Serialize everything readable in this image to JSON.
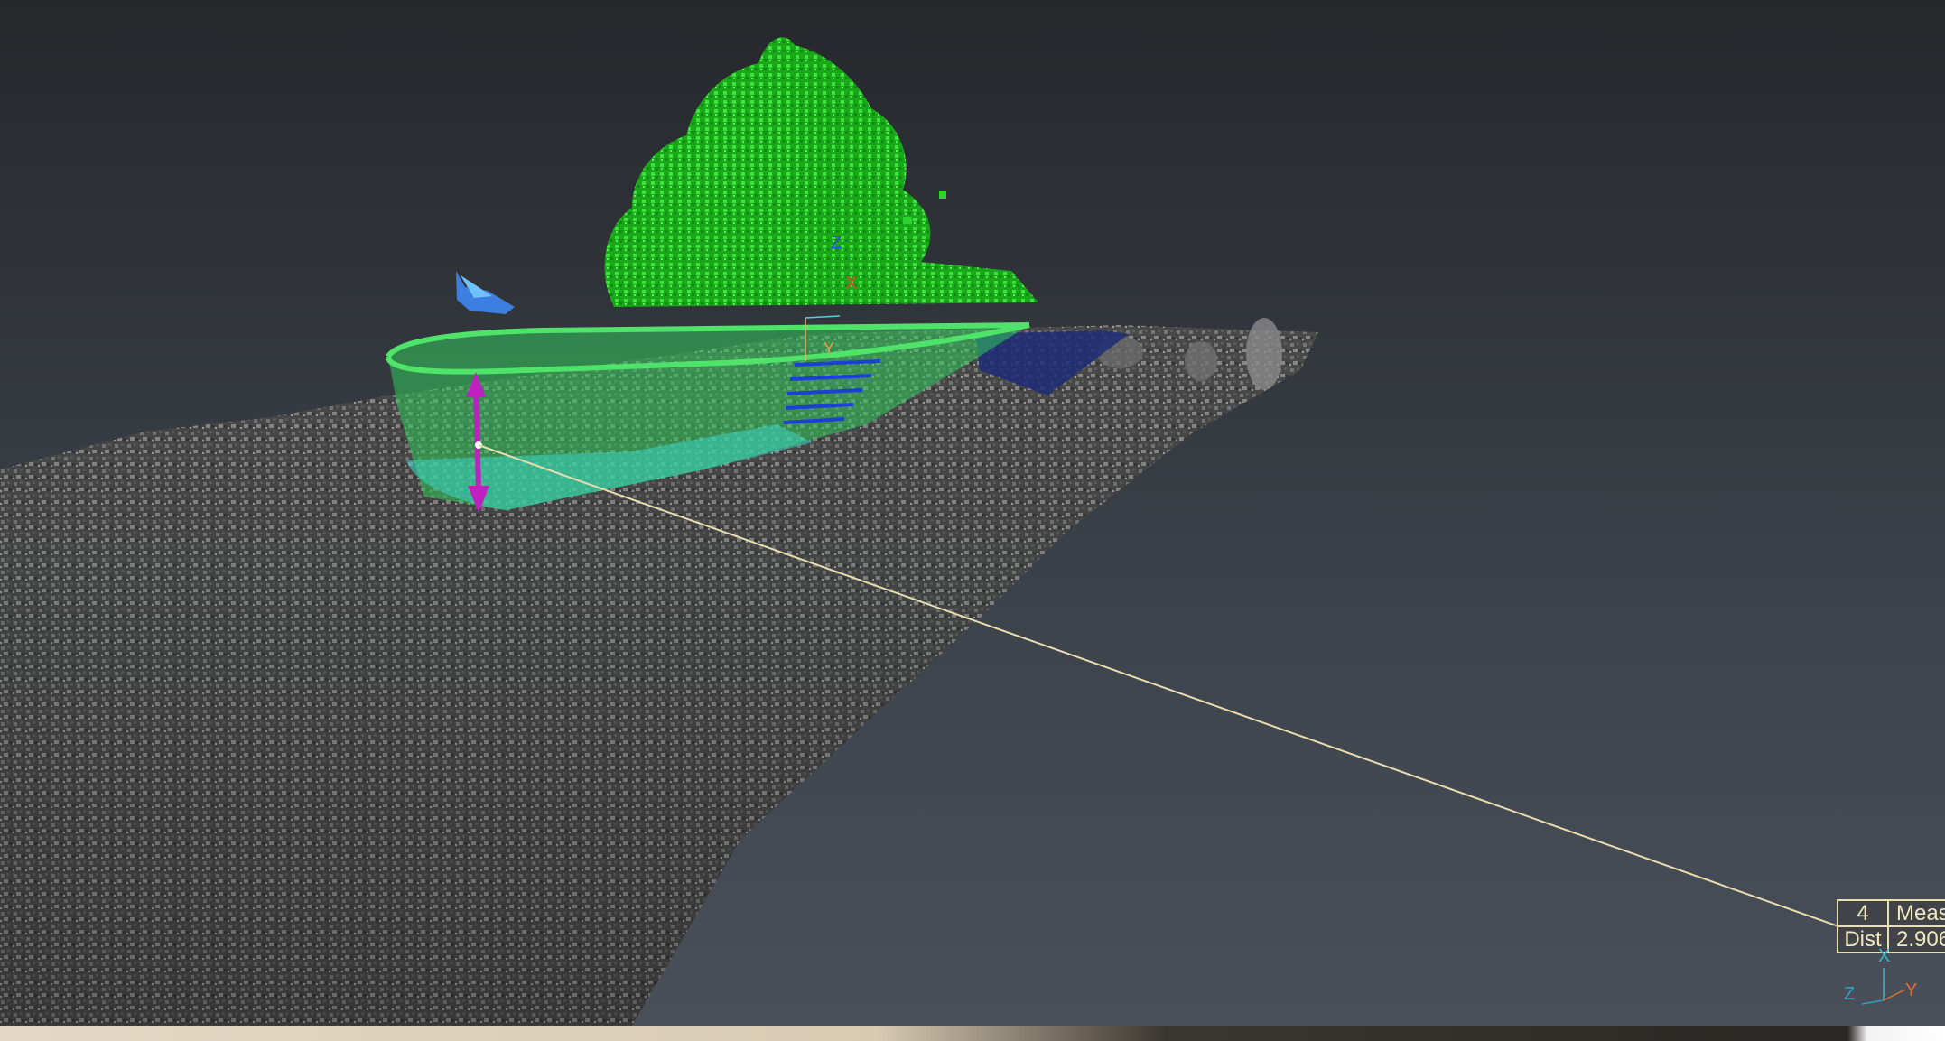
{
  "viewport": {
    "background_top": "#25272b",
    "background_bottom": "#4a5059",
    "pointcloud_color": "#6b6b6b",
    "tree_color": "#1fc81f",
    "pool_color": "#35d24a",
    "pool_water_color": "#3ad6c2",
    "stairs_color": "#1b3fd8",
    "measure_arrow_color": "#c020c0",
    "leader_line_color": "#e8ddb0"
  },
  "scene_gizmo": {
    "z_label": "Z",
    "x_label": "X",
    "y_label": "Y"
  },
  "measurement": {
    "id": "4",
    "title": "Meas",
    "dist_label": "Dist",
    "dist_value": "2.906"
  },
  "axis_widget": {
    "x_label": "X",
    "y_label": "Y",
    "z_label": "Z"
  }
}
